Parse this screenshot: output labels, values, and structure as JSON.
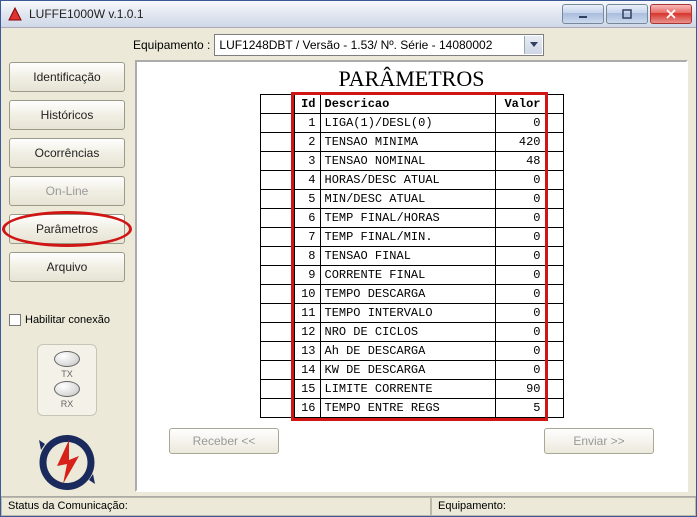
{
  "window": {
    "title": "LUFFE1000W v.1.0.1"
  },
  "equipamento": {
    "label": "Equipamento :",
    "value": "LUF1248DBT / Versão - 1.53/ Nº. Série - 14080002"
  },
  "sidebar": {
    "identificacao": "Identificação",
    "historicos": "Históricos",
    "ocorrencias": "Ocorrências",
    "online": "On-Line",
    "parametros": "Parâmetros",
    "arquivo": "Arquivo",
    "habilitar": "Habilitar conexão",
    "tx": "TX",
    "rx": "RX"
  },
  "panel": {
    "title": "PARÂMETROS",
    "headers": {
      "id": "Id",
      "desc": "Descricao",
      "val": "Valor"
    },
    "rows": [
      {
        "id": "1",
        "desc": "LIGA(1)/DESL(0)",
        "val": "0"
      },
      {
        "id": "2",
        "desc": "TENSAO MINIMA",
        "val": "420"
      },
      {
        "id": "3",
        "desc": "TENSAO NOMINAL",
        "val": "48"
      },
      {
        "id": "4",
        "desc": "HORAS/DESC ATUAL",
        "val": "0"
      },
      {
        "id": "5",
        "desc": "MIN/DESC ATUAL",
        "val": "0"
      },
      {
        "id": "6",
        "desc": "TEMP FINAL/HORAS",
        "val": "0"
      },
      {
        "id": "7",
        "desc": "TEMP FINAL/MIN.",
        "val": "0"
      },
      {
        "id": "8",
        "desc": "TENSAO FINAL",
        "val": "0"
      },
      {
        "id": "9",
        "desc": "CORRENTE FINAL",
        "val": "0"
      },
      {
        "id": "10",
        "desc": "TEMPO DESCARGA",
        "val": "0"
      },
      {
        "id": "11",
        "desc": "TEMPO INTERVALO",
        "val": "0"
      },
      {
        "id": "12",
        "desc": "NRO DE CICLOS",
        "val": "0"
      },
      {
        "id": "13",
        "desc": "Ah DE DESCARGA",
        "val": "0"
      },
      {
        "id": "14",
        "desc": "KW DE DESCARGA",
        "val": "0"
      },
      {
        "id": "15",
        "desc": "LIMITE CORRENTE",
        "val": "90"
      },
      {
        "id": "16",
        "desc": "TEMPO ENTRE REGS",
        "val": "5"
      }
    ],
    "receber": "Receber <<",
    "enviar": "Enviar >>"
  },
  "status": {
    "comunicacao": "Status da Comunicação:",
    "equipamento": "Equipamento:"
  }
}
